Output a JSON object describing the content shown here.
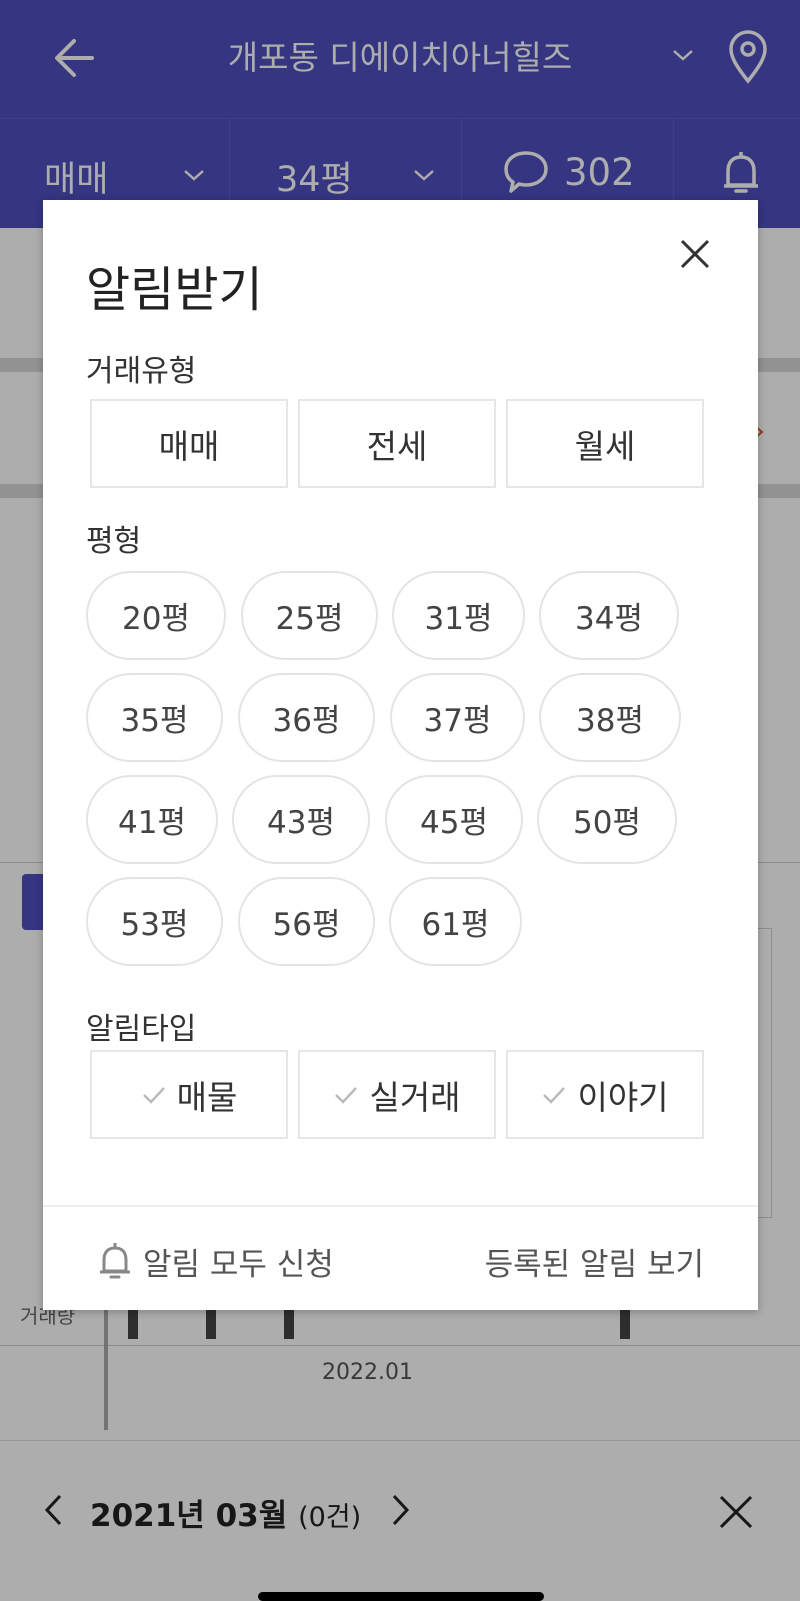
{
  "header": {
    "title": "개포동 디에이치아너힐즈",
    "deal_filter": "매매",
    "size_filter": "34평",
    "comment_count": "302"
  },
  "background": {
    "axis_label": "거래량",
    "date_tick": "2022.01",
    "footer_date": "2021년 03월",
    "footer_count": "(0건)"
  },
  "modal": {
    "title": "알림받기",
    "deal_type_label": "거래유형",
    "deal_types": [
      "매매",
      "전세",
      "월세"
    ],
    "size_label": "평형",
    "sizes": [
      "20평",
      "25평",
      "31평",
      "34평",
      "35평",
      "36평",
      "37평",
      "38평",
      "41평",
      "43평",
      "45평",
      "50평",
      "53평",
      "56평",
      "61평"
    ],
    "alert_type_label": "알림타입",
    "alert_types": [
      "매물",
      "실거래",
      "이야기"
    ],
    "footer": {
      "apply_all": "알림 모두 신청",
      "view_registered": "등록된 알림 보기"
    }
  },
  "colors": {
    "brand": "#4f4fbf",
    "dim_overlay": "rgba(0,0,0,0.32)",
    "pill_border": "#e4e4e4"
  },
  "icons": {
    "back": "arrow-left-icon",
    "location": "map-pin-icon",
    "comment": "speech-bubble-icon",
    "notification": "bell-icon",
    "close": "close-icon",
    "check": "check-icon"
  }
}
